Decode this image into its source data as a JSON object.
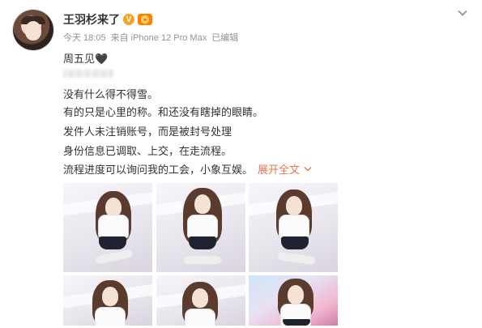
{
  "user": {
    "name": "王羽杉来了",
    "verified_badge": "V"
  },
  "meta": {
    "time": "今天 18:05",
    "source": "来自 iPhone 12 Pro Max",
    "edited": "已编辑"
  },
  "post": {
    "lines": [
      "周五见🖤",
      "没有什么得不得雪。",
      "有的只是心里的称。和还没有瞎掉的眼睛。",
      "发件人未注销账号，而是被封号处理",
      "身份信息已调取、上交，在走流程。",
      "流程进度可以询问我的工会，小象互娱。"
    ],
    "expand_label": "展开全文",
    "expand_icon": "chevron-down-icon"
  },
  "photos": {
    "count": 6,
    "items": [
      "photo-1",
      "photo-2",
      "photo-3",
      "photo-4",
      "photo-5",
      "photo-6"
    ]
  },
  "colors": {
    "link": "#eb7350",
    "meta": "#939393",
    "badge_v": "#f8a325",
    "member": "#ff8200"
  }
}
